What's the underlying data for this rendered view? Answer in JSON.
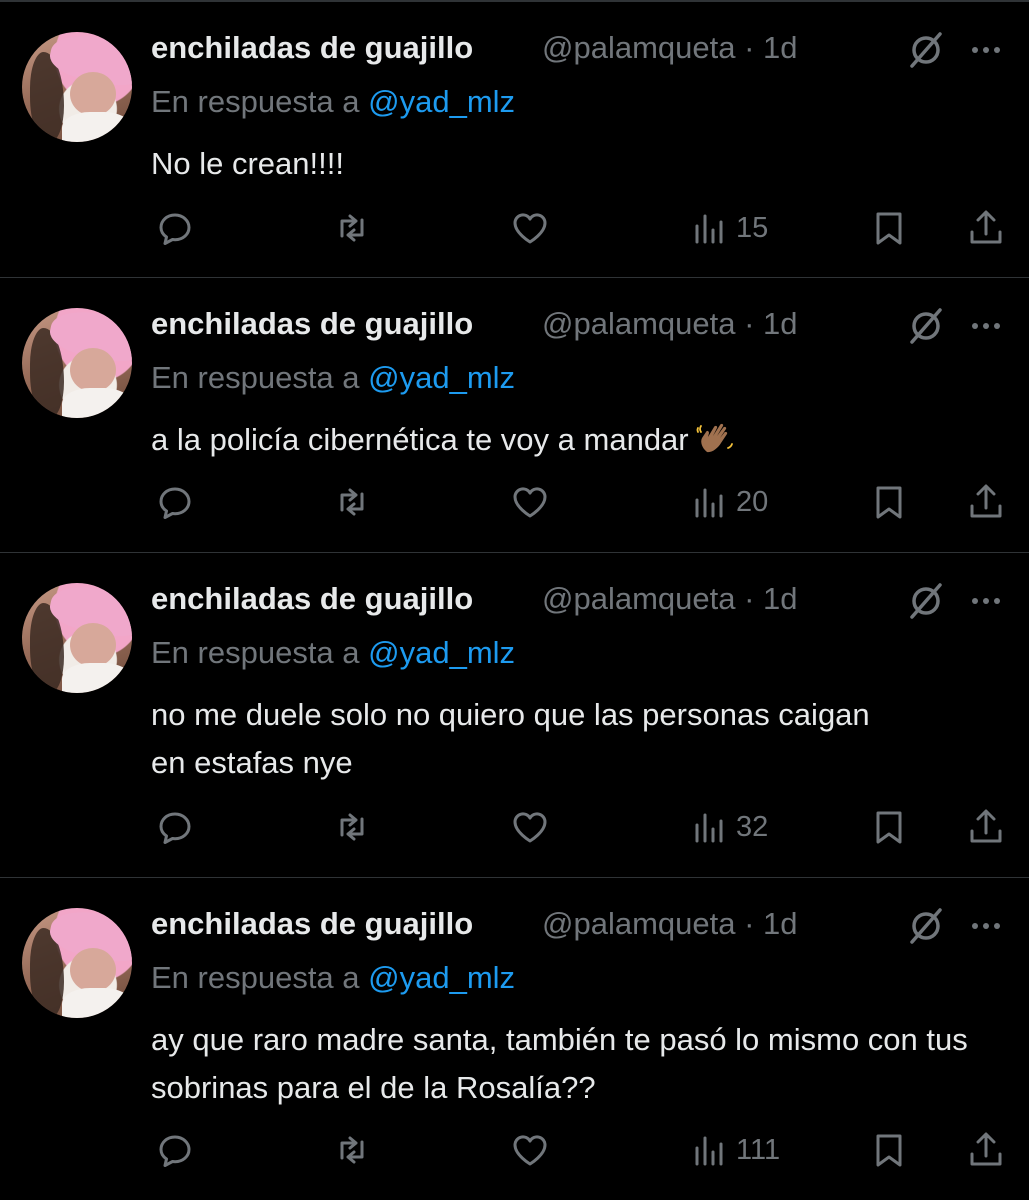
{
  "tweets": [
    {
      "author_name": "enchiladas de guajillo",
      "handle": "@palamqueta",
      "time": "· 1d",
      "reply_prefix": "En respuesta a",
      "reply_to": "@yad_mlz",
      "text": "No le crean!!!!",
      "views": "15"
    },
    {
      "author_name": "enchiladas de guajillo",
      "handle": "@palamqueta",
      "time": "· 1d",
      "reply_prefix": "En respuesta a",
      "reply_to": "@yad_mlz",
      "text": "a la policía cibernética te voy a mandar",
      "emoji": "👋🏾",
      "views": "20"
    },
    {
      "author_name": "enchiladas de guajillo",
      "handle": "@palamqueta",
      "time": "· 1d",
      "reply_prefix": "En respuesta a",
      "reply_to": "@yad_mlz",
      "text": "no me duele solo no quiero que las personas caigan en estafas nye",
      "views": "32"
    },
    {
      "author_name": "enchiladas de guajillo",
      "handle": "@palamqueta",
      "time": "· 1d",
      "reply_prefix": "En respuesta a",
      "reply_to": "@yad_mlz",
      "text": "ay que raro madre santa, también te pasó lo mismo con tus sobrinas para el de la Rosalía??",
      "views": "111"
    }
  ],
  "icons": {
    "reply": "reply-icon",
    "retweet": "retweet-icon",
    "like": "like-icon",
    "views": "views-icon",
    "bookmark": "bookmark-icon",
    "share": "share-icon",
    "grok": "grok-icon",
    "more": "more-icon"
  },
  "colors": {
    "background": "#000000",
    "text": "#e7e9ea",
    "secondary": "#71767b",
    "link": "#1d9bf0",
    "divider": "#2f3336"
  }
}
